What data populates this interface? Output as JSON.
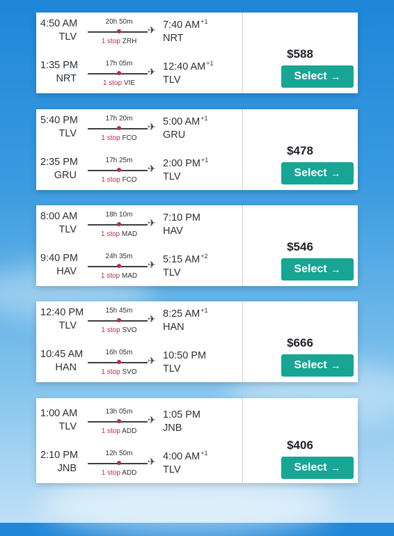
{
  "select_label": "Select",
  "results": [
    {
      "price": "$588",
      "legs": [
        {
          "dep_time": "4:50 AM",
          "dep_code": "TLV",
          "duration": "20h 50m",
          "stops": "1 stop",
          "via": "ZRH",
          "arr_time": "7:40 AM",
          "arr_plus": "+1",
          "arr_code": "NRT"
        },
        {
          "dep_time": "1:35 PM",
          "dep_code": "NRT",
          "duration": "17h 05m",
          "stops": "1 stop",
          "via": "VIE",
          "arr_time": "12:40 AM",
          "arr_plus": "+1",
          "arr_code": "TLV"
        }
      ]
    },
    {
      "price": "$478",
      "legs": [
        {
          "dep_time": "5:40 PM",
          "dep_code": "TLV",
          "duration": "17h 20m",
          "stops": "1 stop",
          "via": "FCO",
          "arr_time": "5:00 AM",
          "arr_plus": "+1",
          "arr_code": "GRU"
        },
        {
          "dep_time": "2:35 PM",
          "dep_code": "GRU",
          "duration": "17h 25m",
          "stops": "1 stop",
          "via": "FCO",
          "arr_time": "2:00 PM",
          "arr_plus": "+1",
          "arr_code": "TLV"
        }
      ]
    },
    {
      "price": "$546",
      "legs": [
        {
          "dep_time": "8:00 AM",
          "dep_code": "TLV",
          "duration": "18h 10m",
          "stops": "1 stop",
          "via": "MAD",
          "arr_time": "7:10 PM",
          "arr_plus": "",
          "arr_code": "HAV"
        },
        {
          "dep_time": "9:40 PM",
          "dep_code": "HAV",
          "duration": "24h 35m",
          "stops": "1 stop",
          "via": "MAD",
          "arr_time": "5:15 AM",
          "arr_plus": "+2",
          "arr_code": "TLV"
        }
      ]
    },
    {
      "price": "$666",
      "legs": [
        {
          "dep_time": "12:40 PM",
          "dep_code": "TLV",
          "duration": "15h 45m",
          "stops": "1 stop",
          "via": "SVO",
          "arr_time": "8:25 AM",
          "arr_plus": "+1",
          "arr_code": "HAN"
        },
        {
          "dep_time": "10:45 AM",
          "dep_code": "HAN",
          "duration": "16h 05m",
          "stops": "1 stop",
          "via": "SVO",
          "arr_time": "10:50 PM",
          "arr_plus": "",
          "arr_code": "TLV"
        }
      ]
    },
    {
      "price": "$406",
      "legs": [
        {
          "dep_time": "1:00 AM",
          "dep_code": "TLV",
          "duration": "13h 05m",
          "stops": "1 stop",
          "via": "ADD",
          "arr_time": "1:05 PM",
          "arr_plus": "",
          "arr_code": "JNB"
        },
        {
          "dep_time": "2:10 PM",
          "dep_code": "JNB",
          "duration": "12h 50m",
          "stops": "1 stop",
          "via": "ADD",
          "arr_time": "4:00 AM",
          "arr_plus": "+1",
          "arr_code": "TLV"
        }
      ]
    }
  ]
}
